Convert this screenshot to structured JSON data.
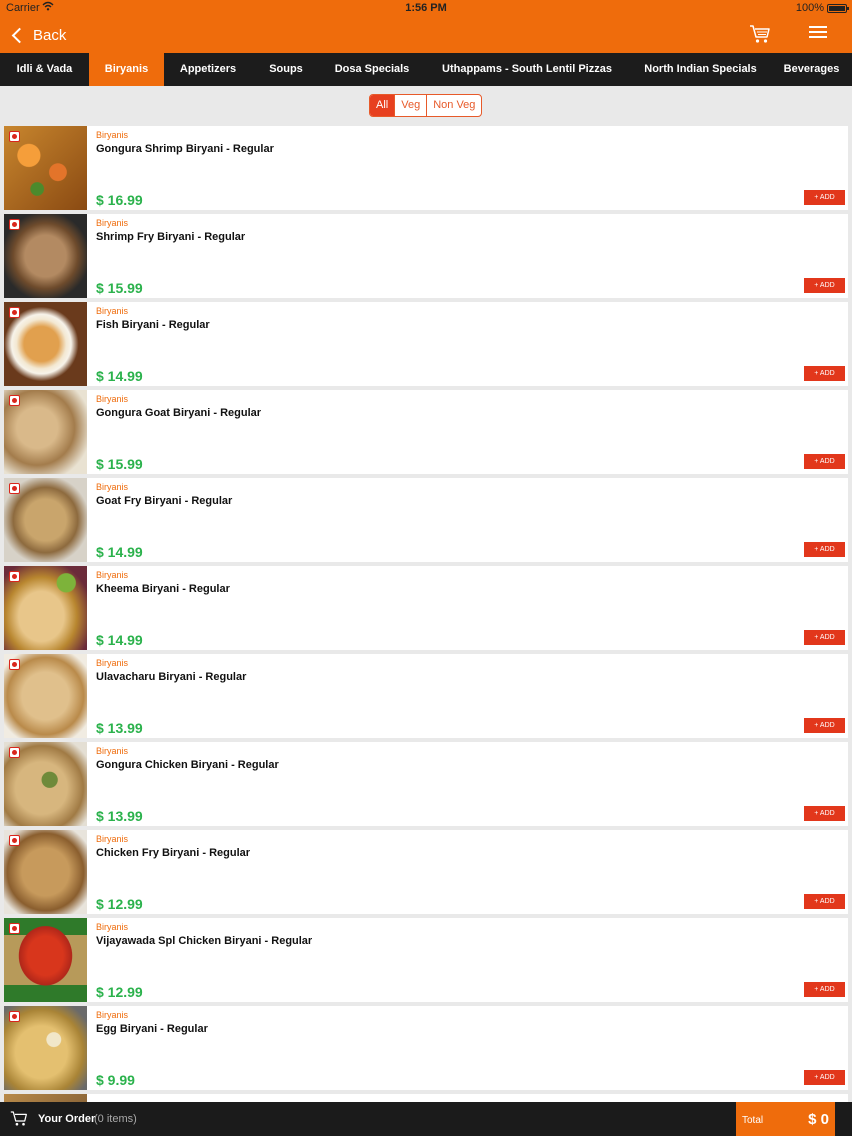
{
  "status": {
    "carrier": "Carrier",
    "time": "1:56 PM",
    "battery": "100%"
  },
  "header": {
    "back_label": "Back"
  },
  "tabs": [
    {
      "label": "Idli & Vada",
      "active": false
    },
    {
      "label": "Biryanis",
      "active": true
    },
    {
      "label": "Appetizers",
      "active": false
    },
    {
      "label": "Soups",
      "active": false
    },
    {
      "label": "Dosa Specials",
      "active": false
    },
    {
      "label": "Uthappams - South Lentil Pizzas",
      "active": false
    },
    {
      "label": "North Indian Specials",
      "active": false
    },
    {
      "label": "Beverages",
      "active": false
    }
  ],
  "filter": {
    "options": [
      "All",
      "Veg",
      "Non Veg"
    ],
    "selected": "All"
  },
  "items": [
    {
      "category": "Biryanis",
      "name": "Gongura Shrimp Biryani - Regular",
      "price": "$ 16.99",
      "add_label": "+ ADD"
    },
    {
      "category": "Biryanis",
      "name": "Shrimp Fry Biryani - Regular",
      "price": "$ 15.99",
      "add_label": "+ ADD"
    },
    {
      "category": "Biryanis",
      "name": "Fish Biryani - Regular",
      "price": "$ 14.99",
      "add_label": "+ ADD"
    },
    {
      "category": "Biryanis",
      "name": "Gongura Goat Biryani - Regular",
      "price": "$ 15.99",
      "add_label": "+ ADD"
    },
    {
      "category": "Biryanis",
      "name": "Goat Fry Biryani - Regular",
      "price": "$ 14.99",
      "add_label": "+ ADD"
    },
    {
      "category": "Biryanis",
      "name": "Kheema Biryani - Regular",
      "price": "$ 14.99",
      "add_label": "+ ADD"
    },
    {
      "category": "Biryanis",
      "name": "Ulavacharu Biryani - Regular",
      "price": "$ 13.99",
      "add_label": "+ ADD"
    },
    {
      "category": "Biryanis",
      "name": "Gongura Chicken Biryani - Regular",
      "price": "$ 13.99",
      "add_label": "+ ADD"
    },
    {
      "category": "Biryanis",
      "name": "Chicken Fry Biryani - Regular",
      "price": "$ 12.99",
      "add_label": "+ ADD"
    },
    {
      "category": "Biryanis",
      "name": "Vijayawada Spl Chicken Biryani - Regular",
      "price": "$ 12.99",
      "add_label": "+ ADD"
    },
    {
      "category": "Biryanis",
      "name": "Egg Biryani - Regular",
      "price": "$ 9.99",
      "add_label": "+ ADD"
    }
  ],
  "bottom": {
    "order_label": "Your Order",
    "order_count": "(0 items)",
    "total_label": "Total",
    "total_value": "$ 0"
  },
  "colors": {
    "brand": "#ef6c0c",
    "tab_bar": "#1c1c1c",
    "price": "#2bb24c",
    "add_button": "#e2371b"
  }
}
